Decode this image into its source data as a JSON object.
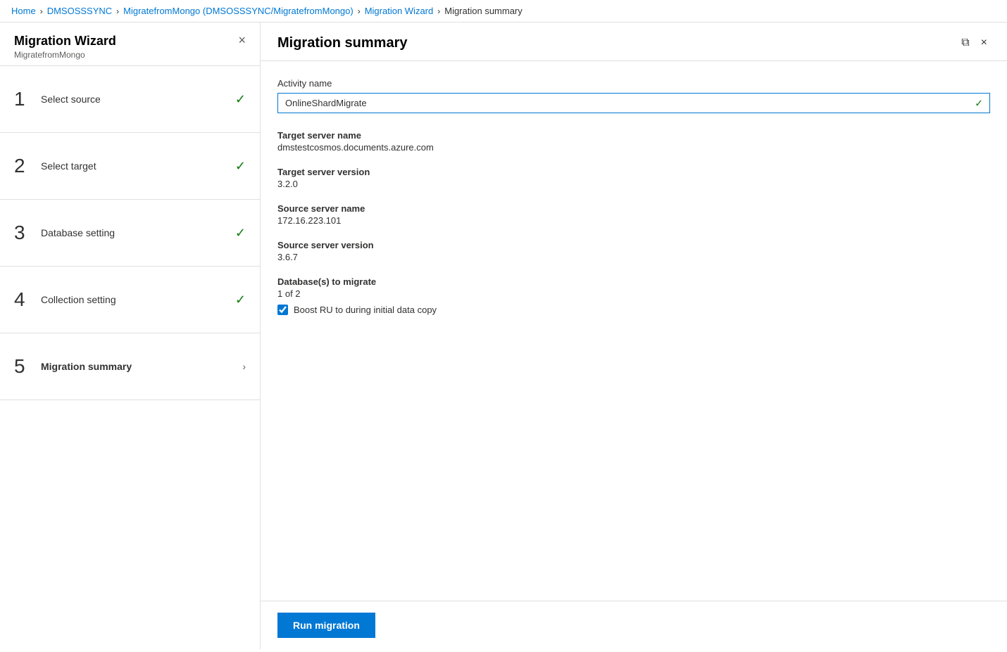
{
  "breadcrumb": {
    "items": [
      {
        "label": "Home",
        "link": true
      },
      {
        "label": "DMSOSSSYNC",
        "link": true
      },
      {
        "label": "MigratefromMongo (DMSOSSSYNC/MigratefromMongo)",
        "link": true
      },
      {
        "label": "Migration Wizard",
        "link": true
      },
      {
        "label": "Migration summary",
        "link": false
      }
    ],
    "separator": ">"
  },
  "wizard": {
    "title": "Migration Wizard",
    "subtitle": "MigratefromMongo",
    "close_label": "×"
  },
  "steps": [
    {
      "number": "1",
      "label": "Select source",
      "status": "check"
    },
    {
      "number": "2",
      "label": "Select target",
      "status": "check"
    },
    {
      "number": "3",
      "label": "Database setting",
      "status": "check"
    },
    {
      "number": "4",
      "label": "Collection setting",
      "status": "check"
    },
    {
      "number": "5",
      "label": "Migration summary",
      "status": "arrow"
    }
  ],
  "right_panel": {
    "title": "Migration summary",
    "window_controls": {
      "restore_label": "⧉",
      "close_label": "×"
    }
  },
  "form": {
    "activity_name_label": "Activity name",
    "activity_name_value": "OnlineShardMigrate",
    "target_server_name_label": "Target server name",
    "target_server_name_value": "dmstestcosmos.documents.azure.com",
    "target_server_version_label": "Target server version",
    "target_server_version_value": "3.2.0",
    "source_server_name_label": "Source server name",
    "source_server_name_value": "172.16.223.101",
    "source_server_version_label": "Source server version",
    "source_server_version_value": "3.6.7",
    "databases_to_migrate_label": "Database(s) to migrate",
    "databases_to_migrate_value": "1 of 2",
    "boost_label": "Boost RU to during initial data copy",
    "boost_checked": true
  },
  "footer": {
    "run_button_label": "Run migration"
  }
}
